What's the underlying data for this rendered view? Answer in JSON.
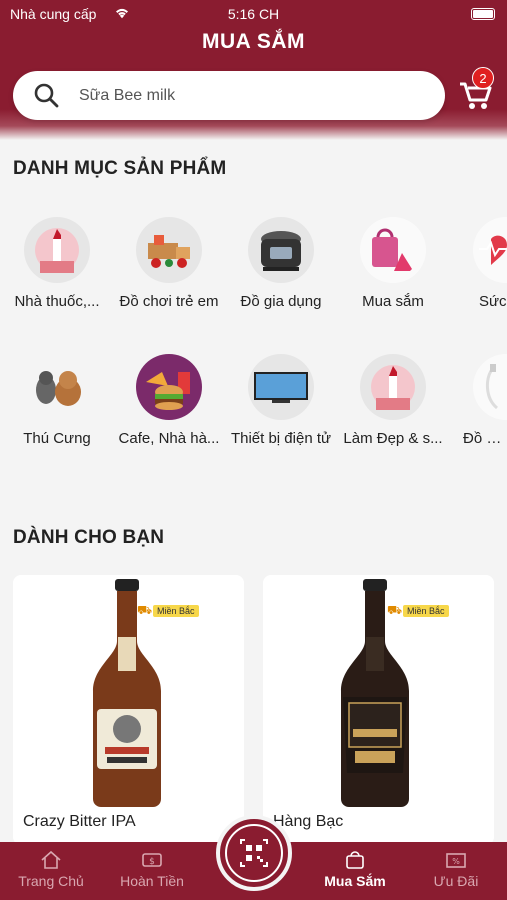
{
  "status": {
    "carrier": "Nhà cung cấp",
    "time": "5:16 CH"
  },
  "header": {
    "title": "MUA SẮM"
  },
  "search": {
    "placeholder": "Sữa Bee milk"
  },
  "cart": {
    "count": "2"
  },
  "categories_section": {
    "title": "DANH MỤC SẢN PHẨM",
    "row1": [
      {
        "label": "Nhà thuốc,...",
        "icon": "lipstick-icon"
      },
      {
        "label": "Đồ chơi trẻ em",
        "icon": "toy-truck-icon"
      },
      {
        "label": "Đồ gia dụng",
        "icon": "rice-cooker-icon"
      },
      {
        "label": "Mua sắm",
        "icon": "shopping-bag-icon"
      },
      {
        "label": "Sức",
        "icon": "heart-pulse-icon"
      }
    ],
    "row2": [
      {
        "label": "Thú Cưng",
        "icon": "pets-icon"
      },
      {
        "label": "Cafe, Nhà hà...",
        "icon": "fast-food-icon"
      },
      {
        "label": "Thiết bị điện tử",
        "icon": "tv-icon"
      },
      {
        "label": "Làm Đẹp & s...",
        "icon": "lipstick-icon"
      },
      {
        "label": "Đồ côn",
        "icon": "cable-icon"
      }
    ]
  },
  "for_you": {
    "title": "DÀNH CHO BẠN",
    "products": [
      {
        "name": "Crazy Bitter IPA",
        "shipping": "Miền Bắc"
      },
      {
        "name": "Hàng Bạc",
        "shipping": "Miền Bắc"
      }
    ]
  },
  "tabbar": {
    "items": [
      {
        "label": "Trang Chủ",
        "icon": "home-icon"
      },
      {
        "label": "Hoàn Tiền",
        "icon": "cashback-icon"
      },
      {
        "label": "Mua Sắm",
        "icon": "shopping-bag-icon"
      },
      {
        "label": "Ưu Đãi",
        "icon": "coupon-icon"
      }
    ],
    "active": "Mua Sắm"
  },
  "colors": {
    "brand": "#8a1c30",
    "badge": "#e02020"
  }
}
